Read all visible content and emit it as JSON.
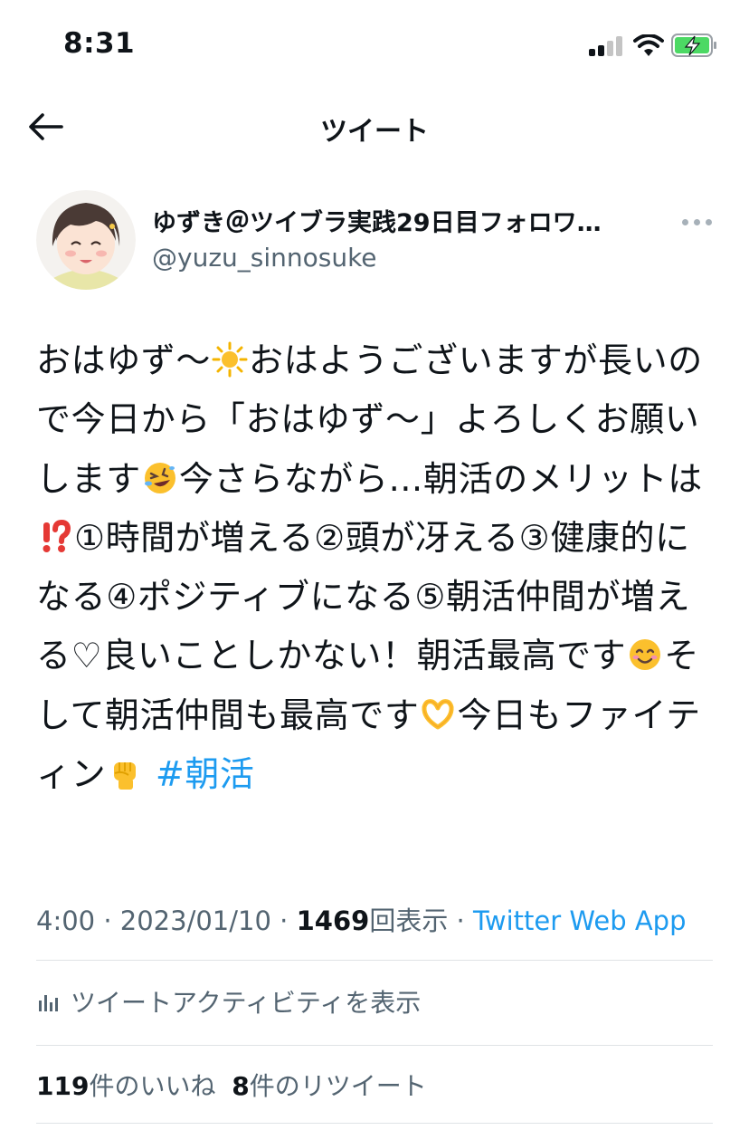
{
  "status_bar": {
    "time": "8:31"
  },
  "nav": {
    "title": "ツイート"
  },
  "author": {
    "display_name": "ゆずき＠ツイブラ実践29日目フォロワ…",
    "handle": "@yuzu_sinnosuke"
  },
  "tweet": {
    "seg1": "おはゆず〜",
    "seg2": "おはようございますが長いので今日から「おはゆず〜」よろしくお願いします",
    "seg3": "今さらながら…朝活のメリットは",
    "seg4": "①時間が増える②頭が冴える③健康的になる④ポジティブになる⑤朝活仲間が増える♡良いことしかない！朝活最高です",
    "seg5": "そして朝活仲間も最高です",
    "seg6": "今日もファイティン",
    "hashtag": "#朝活",
    "emoji_icons": [
      "sun-icon",
      "rolling-laughing-emoji-icon",
      "exclamation-question-icon",
      "smiling-face-icon",
      "heart-hands-icon",
      "raised-fist-icon"
    ]
  },
  "meta": {
    "time": "4:00",
    "date": "2023/01/10",
    "views_count": "1469",
    "views_label": "回表示",
    "source": "Twitter Web App"
  },
  "activity": {
    "label": "ツイートアクティビティを表示"
  },
  "stats": {
    "likes_count": "119",
    "likes_label": "件のいいね",
    "retweets_count": "8",
    "retweets_label": "件のリツイート"
  },
  "colors": {
    "link": "#1d9bf0",
    "secondary_text": "#536471",
    "battery": "#4cd964"
  }
}
